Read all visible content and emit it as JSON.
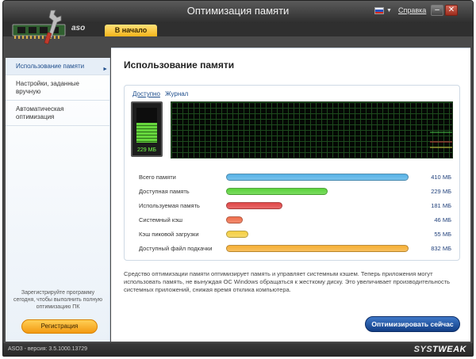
{
  "window": {
    "title": "Оптимизация памяти"
  },
  "topbar": {
    "help_label": "Справка",
    "minimize_label": "–",
    "close_label": "✕",
    "flag_colors": [
      "#ffffff",
      "#2a52be",
      "#d52b1e"
    ]
  },
  "brand_tabs": {
    "logo_text": "aso",
    "home_tab": "В начало"
  },
  "sidebar": {
    "items": [
      {
        "label": "Использование памяти"
      },
      {
        "label": "Настройки, заданные вручную"
      },
      {
        "label": "Автоматическая оптимизация"
      }
    ],
    "promo_text": "Зарегистрируйте программу сегодня, чтобы выполнить полную оптимизацию ПК",
    "register_label": "Регистрация"
  },
  "main": {
    "title": "Использование памяти",
    "tabs": [
      {
        "label": "Доступно"
      },
      {
        "label": "Журнал"
      }
    ],
    "meter": {
      "label": "229 МБ",
      "fraction": 0.558
    },
    "stats": [
      {
        "label": "Всего памяти",
        "value": "410 МБ",
        "fraction": 1.0,
        "color": "#56b2e6"
      },
      {
        "label": "Доступная память",
        "value": "229 МБ",
        "fraction": 0.558,
        "color": "#5ad33a"
      },
      {
        "label": "Используемая память",
        "value": "181 МБ",
        "fraction": 0.31,
        "color": "#e04646"
      },
      {
        "label": "Системный кэш",
        "value": "46 МБ",
        "fraction": 0.09,
        "color": "#ef6e4b"
      },
      {
        "label": "Кэш пиковой загрузки",
        "value": "55 МБ",
        "fraction": 0.12,
        "color": "#f4cf42"
      },
      {
        "label": "Доступный файл подкачки",
        "value": "832 МБ",
        "fraction": 1.0,
        "color": "#f6b036"
      }
    ],
    "description": "Средство оптимизации памяти оптимизирует память и управляет системным кэшем. Теперь приложения могут использовать память, не вынуждая ОС Windows обращаться к жесткому диску. Это увеличивает производительность системных приложений, снижая время отклика компьютера.",
    "optimize_label": "Оптимизировать сейчас"
  },
  "statusbar": {
    "version": "ASO3 - версия: 3.5.1000.13729",
    "brand_a": "SYS",
    "brand_b": "TWEAK"
  }
}
